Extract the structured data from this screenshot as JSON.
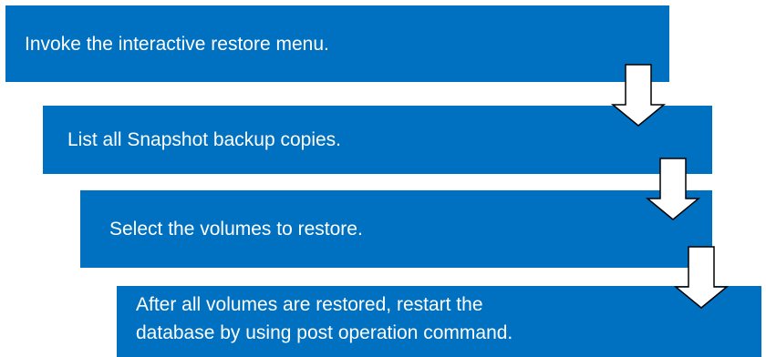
{
  "steps": [
    {
      "label": "Invoke the interactive restore menu."
    },
    {
      "label": "List all Snapshot backup copies."
    },
    {
      "label": "Select the volumes to restore."
    },
    {
      "label": "After all volumes are restored, restart the\ndatabase by using post operation command."
    }
  ],
  "colors": {
    "box_fill": "#0070c0",
    "box_text": "#ffffff",
    "arrow_fill": "#ffffff",
    "arrow_stroke": "#000000"
  }
}
